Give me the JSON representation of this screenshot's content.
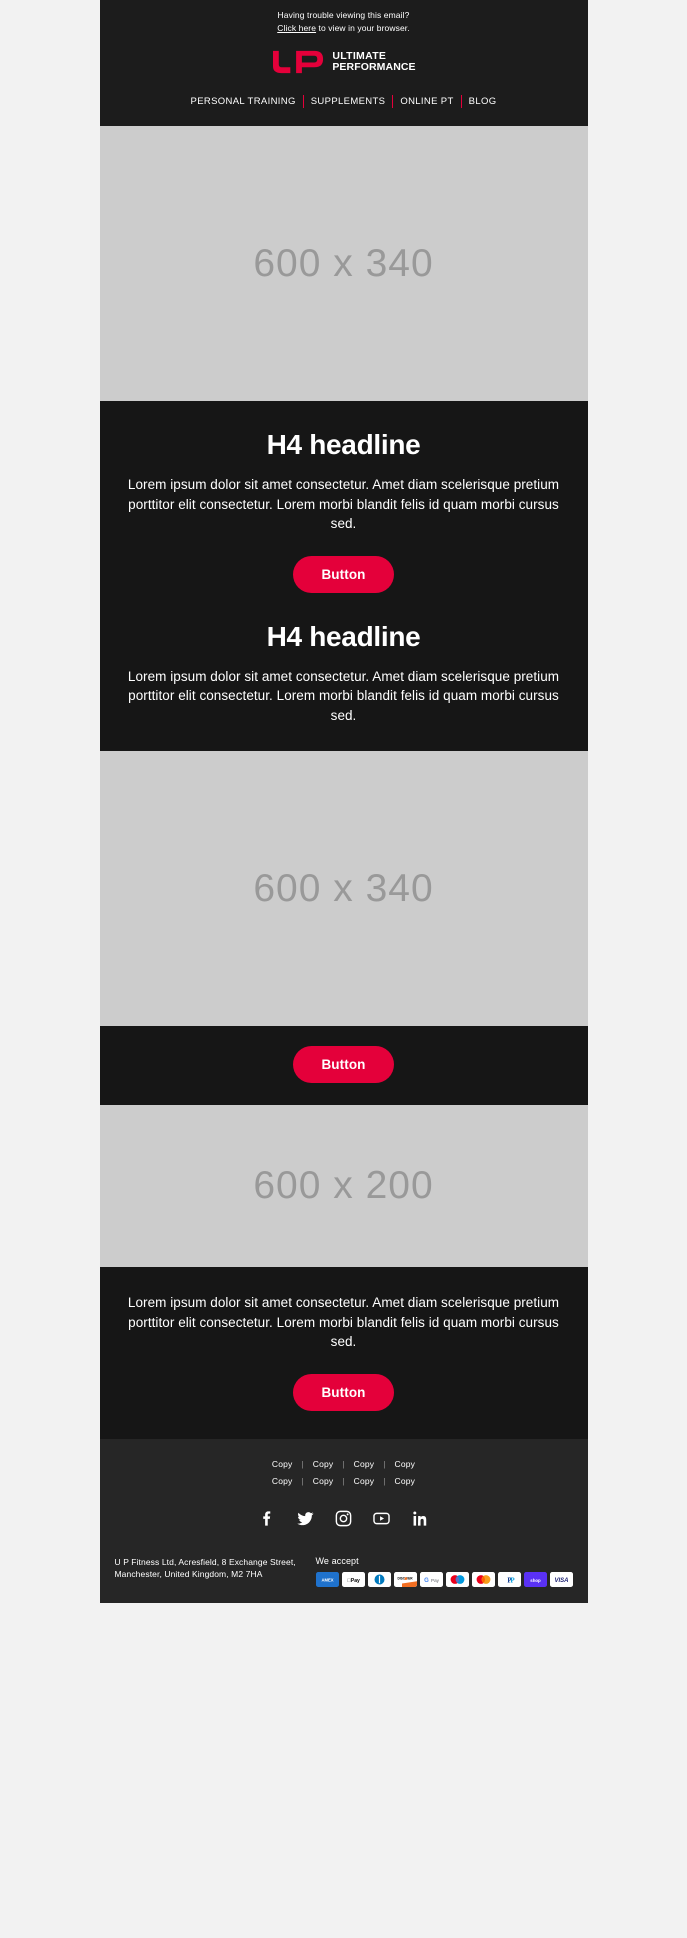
{
  "header": {
    "preheader_line1": "Having trouble viewing this email?",
    "preheader_link": "Click here",
    "preheader_line2": " to view in your browser.",
    "logo_line1": "ULTIMATE",
    "logo_line2": "PERFORMANCE",
    "nav": [
      {
        "label": "PERSONAL TRAINING"
      },
      {
        "label": "SUPPLEMENTS"
      },
      {
        "label": "ONLINE PT"
      },
      {
        "label": "BLOG"
      }
    ]
  },
  "hero_image": {
    "label": "600 x 340"
  },
  "section_one": {
    "headline": "H4 headline",
    "body": "Lorem ipsum dolor sit amet consectetur. Amet diam scelerisque pretium porttitor elit consectetur. Lorem morbi blandit felis id quam morbi cursus sed.",
    "button_label": "Button"
  },
  "section_two": {
    "headline": "H4 headline",
    "body": "Lorem ipsum dolor sit amet consectetur. Amet diam scelerisque pretium porttitor elit consectetur. Lorem morbi blandit felis id quam morbi cursus sed."
  },
  "mid_image": {
    "label": "600 x 340"
  },
  "mid_button": {
    "button_label": "Button"
  },
  "lower_image": {
    "label": "600 x 200"
  },
  "section_three": {
    "body": "Lorem ipsum dolor sit amet consectetur. Amet diam scelerisque pretium porttitor elit consectetur. Lorem morbi blandit felis id quam morbi cursus sed.",
    "button_label": "Button"
  },
  "footer": {
    "links_row1": [
      "Copy",
      "Copy",
      "Copy",
      "Copy"
    ],
    "links_row2": [
      "Copy",
      "Copy",
      "Copy",
      "Copy"
    ],
    "separator": "|",
    "social": [
      {
        "name": "facebook-icon"
      },
      {
        "name": "twitter-icon"
      },
      {
        "name": "instagram-icon"
      },
      {
        "name": "youtube-icon"
      },
      {
        "name": "linkedin-icon"
      }
    ],
    "address": "U P Fitness Ltd, Acresfield, 8 Exchange Street, Manchester, United Kingdom, M2 7HA",
    "accept_label": "We accept",
    "payments": [
      {
        "name": "amex"
      },
      {
        "name": "apple-pay"
      },
      {
        "name": "diners-club"
      },
      {
        "name": "discover"
      },
      {
        "name": "google-pay"
      },
      {
        "name": "maestro"
      },
      {
        "name": "mastercard"
      },
      {
        "name": "paypal"
      },
      {
        "name": "shop-pay"
      },
      {
        "name": "visa"
      }
    ]
  },
  "colors": {
    "brand_red": "#e4003a",
    "dark_bg": "#161616",
    "header_bg": "#1c1c1c",
    "footer_bg": "#262626",
    "placeholder_bg": "#cccccc",
    "placeholder_text": "#999999",
    "page_bg": "#f2f2f2"
  }
}
